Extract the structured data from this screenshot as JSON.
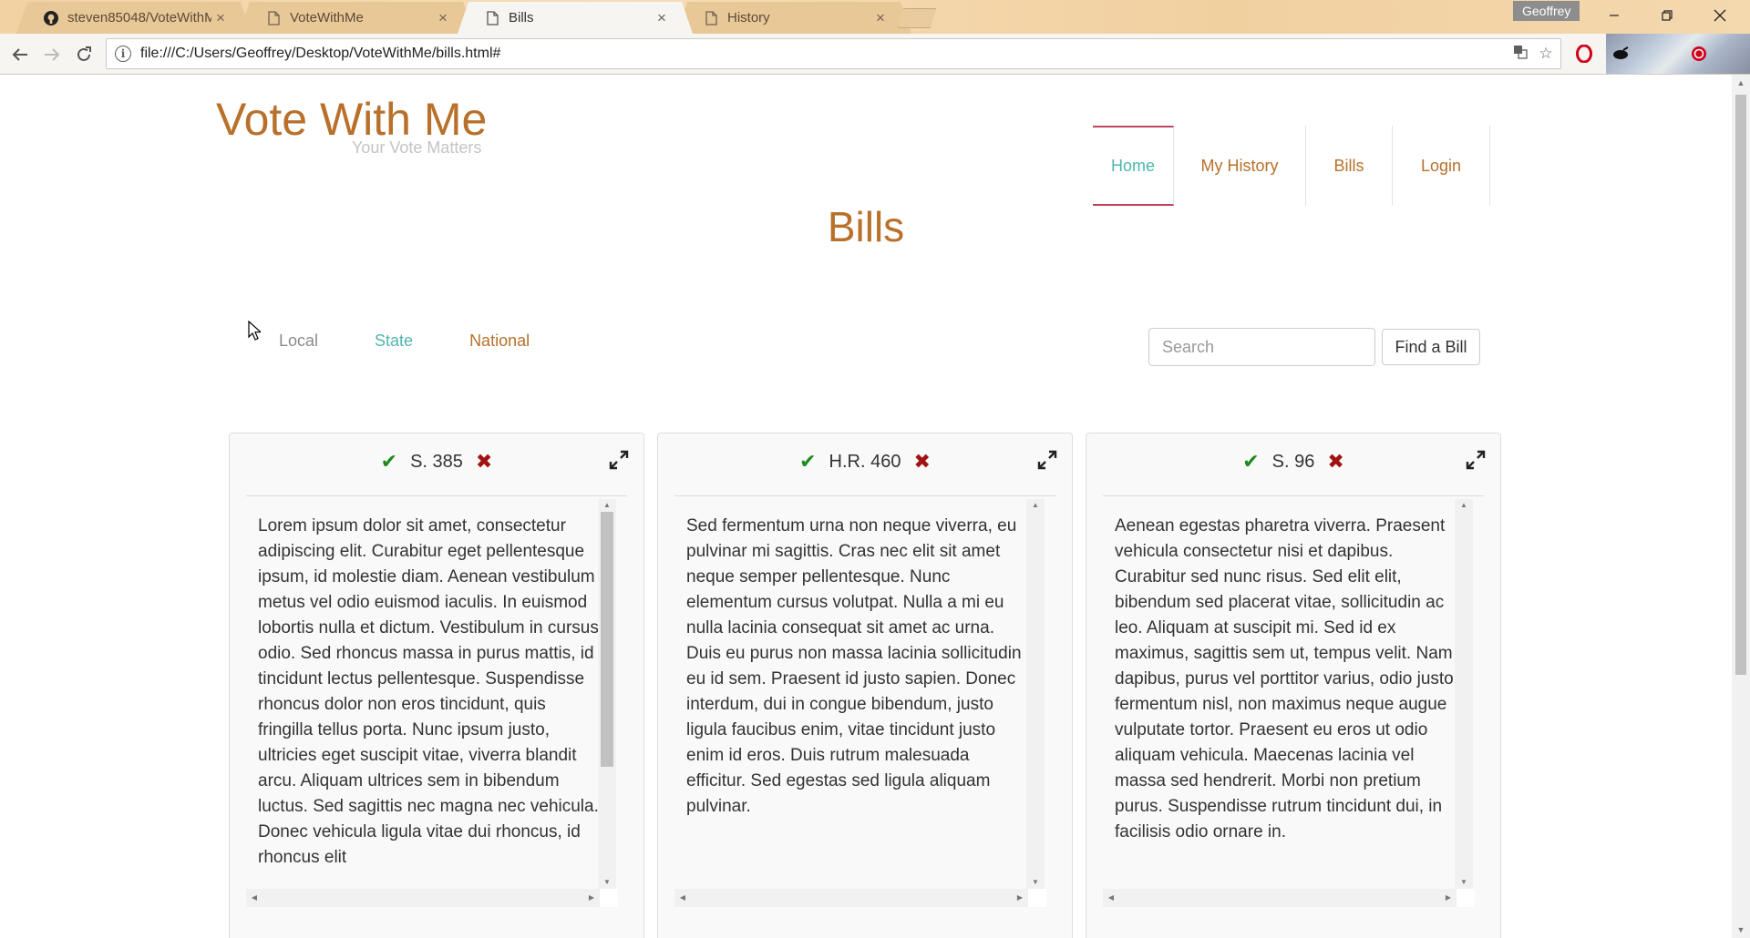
{
  "browser": {
    "tabs": [
      {
        "label": "steven85048/VoteWithMe",
        "icon": "github-icon",
        "active": false
      },
      {
        "label": "VoteWithMe",
        "icon": "page-icon",
        "active": false
      },
      {
        "label": "Bills",
        "icon": "page-icon",
        "active": true
      },
      {
        "label": "History",
        "icon": "page-icon",
        "active": false
      }
    ],
    "profile_name": "Geoffrey",
    "url": "file:///C:/Users/Geoffrey/Desktop/VoteWithMe/bills.html#"
  },
  "site": {
    "title": "Vote With Me",
    "tagline": "Your Vote Matters",
    "nav": [
      {
        "label": "Home",
        "active": true
      },
      {
        "label": "My History",
        "active": false
      },
      {
        "label": "Bills",
        "active": false
      },
      {
        "label": "Login",
        "active": false
      }
    ]
  },
  "page": {
    "heading": "Bills",
    "level_tabs": [
      {
        "label": "Local",
        "color": "#8a8a8a"
      },
      {
        "label": "State",
        "color": "#4fb6ad"
      },
      {
        "label": "National",
        "color": "#b8702a"
      }
    ],
    "search": {
      "placeholder": "Search",
      "value": "",
      "button_label": "Find a Bill"
    }
  },
  "bills": [
    {
      "id": "S. 385",
      "text": "Lorem ipsum dolor sit amet, consectetur adipiscing elit. Curabitur eget pellentesque ipsum, id molestie diam. Aenean vestibulum metus vel odio euismod iaculis. In euismod lobortis nulla et dictum. Vestibulum in cursus odio. Sed rhoncus massa in purus mattis, id tincidunt lectus pellentesque. Suspendisse rhoncus dolor non eros tincidunt, quis fringilla tellus porta. Nunc ipsum justo, ultricies eget suscipit vitae, viverra blandit arcu. Aliquam ultrices sem in bibendum luctus. Sed sagittis nec magna nec vehicula. Donec vehicula ligula vitae dui rhoncus, id rhoncus elit"
    },
    {
      "id": "H.R. 460",
      "text": "Sed fermentum urna non neque viverra, eu pulvinar mi sagittis. Cras nec elit sit amet neque semper pellentesque. Nunc elementum cursus volutpat. Nulla a mi eu nulla lacinia consequat sit amet ac urna. Duis eu purus non massa lacinia sollicitudin eu id sem. Praesent id justo sapien. Donec interdum, dui in congue bibendum, justo ligula faucibus enim, vitae tincidunt justo enim id eros. Duis rutrum malesuada efficitur. Sed egestas sed ligula aliquam pulvinar."
    },
    {
      "id": "S. 96",
      "text": "Aenean egestas pharetra viverra. Praesent vehicula consectetur nisi et dapibus. Curabitur sed nunc risus. Sed elit elit, bibendum sed placerat vitae, sollicitudin ac leo. Aliquam at suscipit mi. Sed id ex maximus, sagittis sem ut, tempus velit. Nam dapibus, purus vel porttitor varius, odio justo fermentum nisl, non maximus neque augue vulputate tortor. Praesent eu eros ut odio aliquam vehicula. Maecenas lacinia vel massa sed hendrerit. Morbi non pretium purus. Suspendisse rutrum tincidunt dui, in facilisis odio ornare in."
    }
  ],
  "colors": {
    "brand": "#b8702a",
    "accent": "#4fb6ad",
    "active_border": "#c0455e",
    "approve": "#1f8a1f",
    "reject": "#a11212"
  }
}
